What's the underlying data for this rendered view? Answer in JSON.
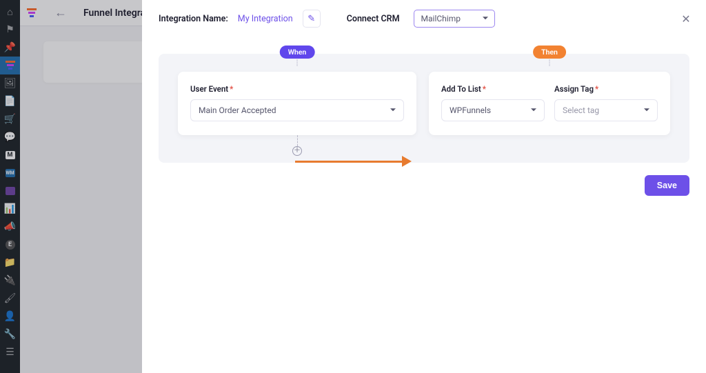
{
  "page": {
    "title": "Funnel Integration"
  },
  "modal": {
    "integration_name_label": "Integration Name:",
    "integration_name_value": "My Integration",
    "connect_crm_label": "Connect CRM",
    "connect_crm_value": "MailChimp"
  },
  "rule": {
    "when_label": "When",
    "then_label": "Then",
    "user_event_label": "User Event",
    "user_event_value": "Main Order Accepted",
    "add_to_list_label": "Add To List",
    "add_to_list_value": "WPFunnels",
    "assign_tag_label": "Assign Tag",
    "assign_tag_placeholder": "Select tag"
  },
  "buttons": {
    "save": "Save"
  },
  "sidebar": {
    "m_label": "M",
    "wm_label": "WM",
    "e_label": "E"
  }
}
